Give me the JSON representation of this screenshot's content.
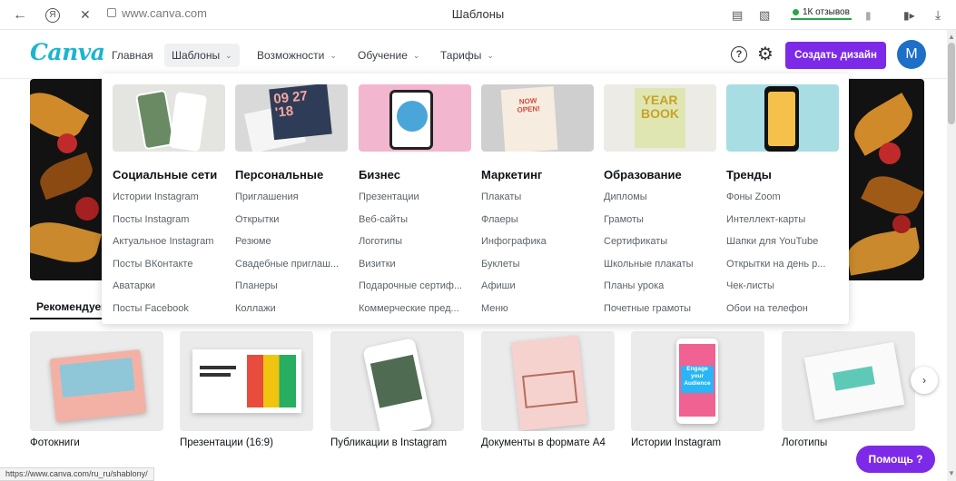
{
  "browser": {
    "url_host": "www.canva.com",
    "tab_title": "Шаблоны",
    "reviews_label": "1К отзывов",
    "status_url": "https://www.canva.com/ru_ru/shablony/"
  },
  "nav": {
    "logo": "Canva",
    "items": [
      {
        "label": "Главная",
        "has_menu": false
      },
      {
        "label": "Шаблоны",
        "has_menu": true,
        "active": true
      },
      {
        "label": "Возможности",
        "has_menu": true
      },
      {
        "label": "Обучение",
        "has_menu": true
      },
      {
        "label": "Тарифы",
        "has_menu": true
      }
    ],
    "help_icon": "?",
    "create_button": "Создать дизайн",
    "avatar_letter": "M"
  },
  "mega_menu": {
    "columns": [
      {
        "heading": "Социальные сети",
        "links": [
          "Истории Instagram",
          "Посты Instagram",
          "Актуальное Instagram",
          "Посты ВКонтакте",
          "Аватарки",
          "Посты Facebook"
        ]
      },
      {
        "heading": "Персональные",
        "thumb_text": "09 27 '18",
        "links": [
          "Приглашения",
          "Открытки",
          "Резюме",
          "Свадебные приглаш...",
          "Планеры",
          "Коллажи"
        ]
      },
      {
        "heading": "Бизнес",
        "links": [
          "Презентации",
          "Веб-сайты",
          "Логотипы",
          "Визитки",
          "Подарочные сертиф...",
          "Коммерческие пред..."
        ]
      },
      {
        "heading": "Маркетинг",
        "thumb_text": "NOW OPEN!",
        "links": [
          "Плакаты",
          "Флаеры",
          "Инфографика",
          "Буклеты",
          "Афиши",
          "Меню"
        ]
      },
      {
        "heading": "Образование",
        "thumb_text": "YEAR BOOK",
        "links": [
          "Дипломы",
          "Грамоты",
          "Сертификаты",
          "Школьные плакаты",
          "Планы урока",
          "Почетные грамоты"
        ]
      },
      {
        "heading": "Тренды",
        "links": [
          "Фоны Zoom",
          "Интеллект-карты",
          "Шапки для YouTube",
          "Открытки на день р...",
          "Чек-листы",
          "Обои на телефон"
        ]
      }
    ]
  },
  "recommended": {
    "label": "Рекомендуем",
    "cards": [
      {
        "label": "Фотокниги"
      },
      {
        "label": "Презентации (16:9)"
      },
      {
        "label": "Публикации в Instagram"
      },
      {
        "label": "Документы в формате A4"
      },
      {
        "label": "Истории Instagram",
        "thumb_text": "Engage your Audience"
      },
      {
        "label": "Логотипы"
      }
    ]
  },
  "help_button": "Помощь ?",
  "colors": {
    "brand_purple": "#7d2ae8",
    "canva_teal": "#1cb5cf",
    "avatar_blue": "#1e6fc7"
  }
}
